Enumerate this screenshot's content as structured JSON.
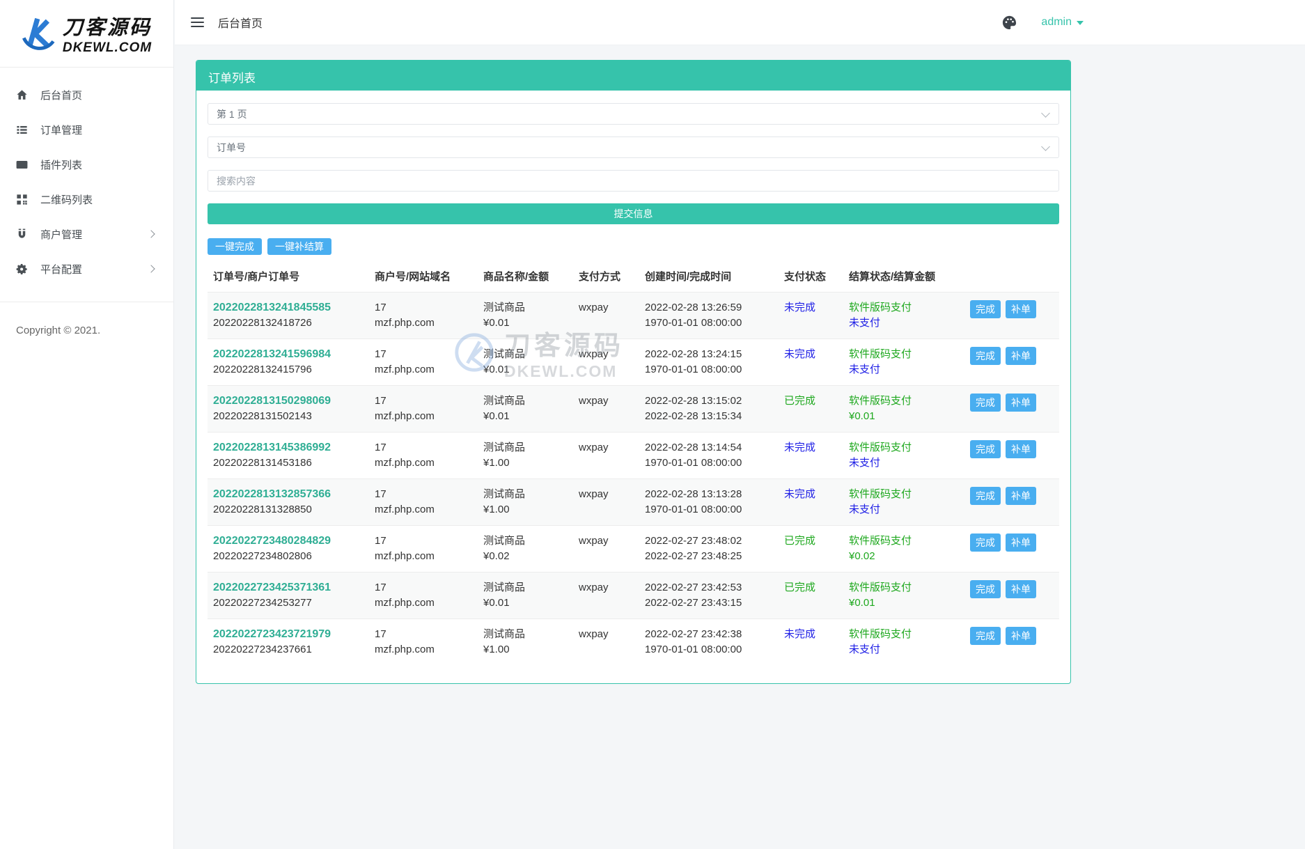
{
  "brand": {
    "cn": "刀客源码",
    "en": "DKEWL.COM"
  },
  "topbar": {
    "page_title": "后台首页",
    "username": "admin"
  },
  "sidebar": {
    "items": [
      {
        "label": "后台首页",
        "icon": "home-icon",
        "submenu": false
      },
      {
        "label": "订单管理",
        "icon": "list-icon",
        "submenu": false
      },
      {
        "label": "插件列表",
        "icon": "plugin-icon",
        "submenu": false
      },
      {
        "label": "二维码列表",
        "icon": "qrcode-icon",
        "submenu": false
      },
      {
        "label": "商户管理",
        "icon": "magnet-icon",
        "submenu": true
      },
      {
        "label": "平台配置",
        "icon": "gear-icon",
        "submenu": true
      }
    ],
    "copyright": "Copyright © 2021."
  },
  "panel": {
    "title": "订单列表",
    "filters": {
      "page": "第 1 页",
      "field": "订单号",
      "search_placeholder": "搜索内容",
      "submit": "提交信息"
    },
    "bulk": {
      "complete_all": "一键完成",
      "settle_all": "一键补结算"
    },
    "table": {
      "headers": [
        "订单号/商户订单号",
        "商户号/网站域名",
        "商品名称/金额",
        "支付方式",
        "创建时间/完成时间",
        "支付状态",
        "结算状态/结算金额"
      ],
      "actions": {
        "complete": "完成",
        "supplement": "补单"
      },
      "rows": [
        {
          "order_no": "2022022813241845585",
          "merchant_order_no": "20220228132418726",
          "merchant_id": "17",
          "domain": "mzf.php.com",
          "product": "测试商品",
          "amount": "¥0.01",
          "pay_method": "wxpay",
          "created": "2022-02-28 13:26:59",
          "completed": "1970-01-01 08:00:00",
          "pay_status": "未完成",
          "pay_state": "pending",
          "settle_method": "软件版码支付",
          "settle_value": "未支付",
          "settle_state": "pending"
        },
        {
          "order_no": "2022022813241596984",
          "merchant_order_no": "20220228132415796",
          "merchant_id": "17",
          "domain": "mzf.php.com",
          "product": "测试商品",
          "amount": "¥0.01",
          "pay_method": "wxpay",
          "created": "2022-02-28 13:24:15",
          "completed": "1970-01-01 08:00:00",
          "pay_status": "未完成",
          "pay_state": "pending",
          "settle_method": "软件版码支付",
          "settle_value": "未支付",
          "settle_state": "pending"
        },
        {
          "order_no": "2022022813150298069",
          "merchant_order_no": "20220228131502143",
          "merchant_id": "17",
          "domain": "mzf.php.com",
          "product": "测试商品",
          "amount": "¥0.01",
          "pay_method": "wxpay",
          "created": "2022-02-28 13:15:02",
          "completed": "2022-02-28 13:15:34",
          "pay_status": "已完成",
          "pay_state": "done",
          "settle_method": "软件版码支付",
          "settle_value": "¥0.01",
          "settle_state": "done"
        },
        {
          "order_no": "2022022813145386992",
          "merchant_order_no": "20220228131453186",
          "merchant_id": "17",
          "domain": "mzf.php.com",
          "product": "测试商品",
          "amount": "¥1.00",
          "pay_method": "wxpay",
          "created": "2022-02-28 13:14:54",
          "completed": "1970-01-01 08:00:00",
          "pay_status": "未完成",
          "pay_state": "pending",
          "settle_method": "软件版码支付",
          "settle_value": "未支付",
          "settle_state": "pending"
        },
        {
          "order_no": "2022022813132857366",
          "merchant_order_no": "20220228131328850",
          "merchant_id": "17",
          "domain": "mzf.php.com",
          "product": "测试商品",
          "amount": "¥1.00",
          "pay_method": "wxpay",
          "created": "2022-02-28 13:13:28",
          "completed": "1970-01-01 08:00:00",
          "pay_status": "未完成",
          "pay_state": "pending",
          "settle_method": "软件版码支付",
          "settle_value": "未支付",
          "settle_state": "pending"
        },
        {
          "order_no": "2022022723480284829",
          "merchant_order_no": "20220227234802806",
          "merchant_id": "17",
          "domain": "mzf.php.com",
          "product": "测试商品",
          "amount": "¥0.02",
          "pay_method": "wxpay",
          "created": "2022-02-27 23:48:02",
          "completed": "2022-02-27 23:48:25",
          "pay_status": "已完成",
          "pay_state": "done",
          "settle_method": "软件版码支付",
          "settle_value": "¥0.02",
          "settle_state": "done"
        },
        {
          "order_no": "2022022723425371361",
          "merchant_order_no": "20220227234253277",
          "merchant_id": "17",
          "domain": "mzf.php.com",
          "product": "测试商品",
          "amount": "¥0.01",
          "pay_method": "wxpay",
          "created": "2022-02-27 23:42:53",
          "completed": "2022-02-27 23:43:15",
          "pay_status": "已完成",
          "pay_state": "done",
          "settle_method": "软件版码支付",
          "settle_value": "¥0.01",
          "settle_state": "done"
        },
        {
          "order_no": "2022022723423721979",
          "merchant_order_no": "20220227234237661",
          "merchant_id": "17",
          "domain": "mzf.php.com",
          "product": "测试商品",
          "amount": "¥1.00",
          "pay_method": "wxpay",
          "created": "2022-02-27 23:42:38",
          "completed": "1970-01-01 08:00:00",
          "pay_status": "未完成",
          "pay_state": "pending",
          "settle_method": "软件版码支付",
          "settle_value": "未支付",
          "settle_state": "pending"
        }
      ]
    }
  },
  "watermark": {
    "cn": "刀客源码",
    "en": "DKEWL.COM"
  },
  "colors": {
    "accent_teal": "#36c3ab",
    "accent_blue": "#49aef0",
    "status_green": "#1ea81e",
    "status_blue": "#2020e6",
    "order_link_teal": "#2fae94",
    "logo_blue": "#2c7cd4"
  }
}
